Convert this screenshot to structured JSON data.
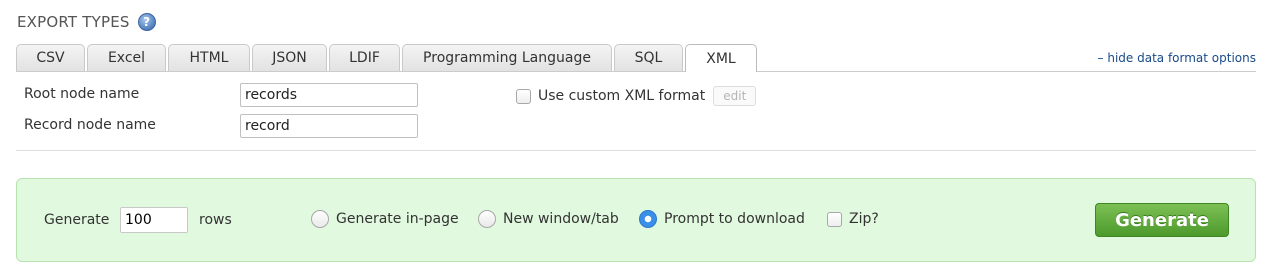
{
  "header": {
    "title": "EXPORT TYPES",
    "help_icon": "?"
  },
  "tabs": [
    {
      "label": "CSV"
    },
    {
      "label": "Excel"
    },
    {
      "label": "HTML"
    },
    {
      "label": "JSON"
    },
    {
      "label": "LDIF"
    },
    {
      "label": "Programming Language"
    },
    {
      "label": "SQL"
    },
    {
      "label": "XML"
    }
  ],
  "active_tab": "XML",
  "hide_link": "– hide data format options",
  "xml_options": {
    "root_node_label": "Root node name",
    "root_node_value": "records",
    "record_node_label": "Record node name",
    "record_node_value": "record",
    "custom_format_label": "Use custom XML format",
    "custom_format_checked": false,
    "edit_label": "edit"
  },
  "generate": {
    "prefix": "Generate",
    "rows_value": "100",
    "suffix": "rows",
    "options": [
      {
        "label": "Generate in-page",
        "checked": false
      },
      {
        "label": "New window/tab",
        "checked": false
      },
      {
        "label": "Prompt to download",
        "checked": true
      }
    ],
    "zip_label": "Zip?",
    "zip_checked": false,
    "button_label": "Generate"
  },
  "colors": {
    "panel_bg": "#e1f9df",
    "button_green": "#5aa836",
    "link_blue": "#1a4a8a",
    "radio_blue": "#3a8fe8"
  }
}
